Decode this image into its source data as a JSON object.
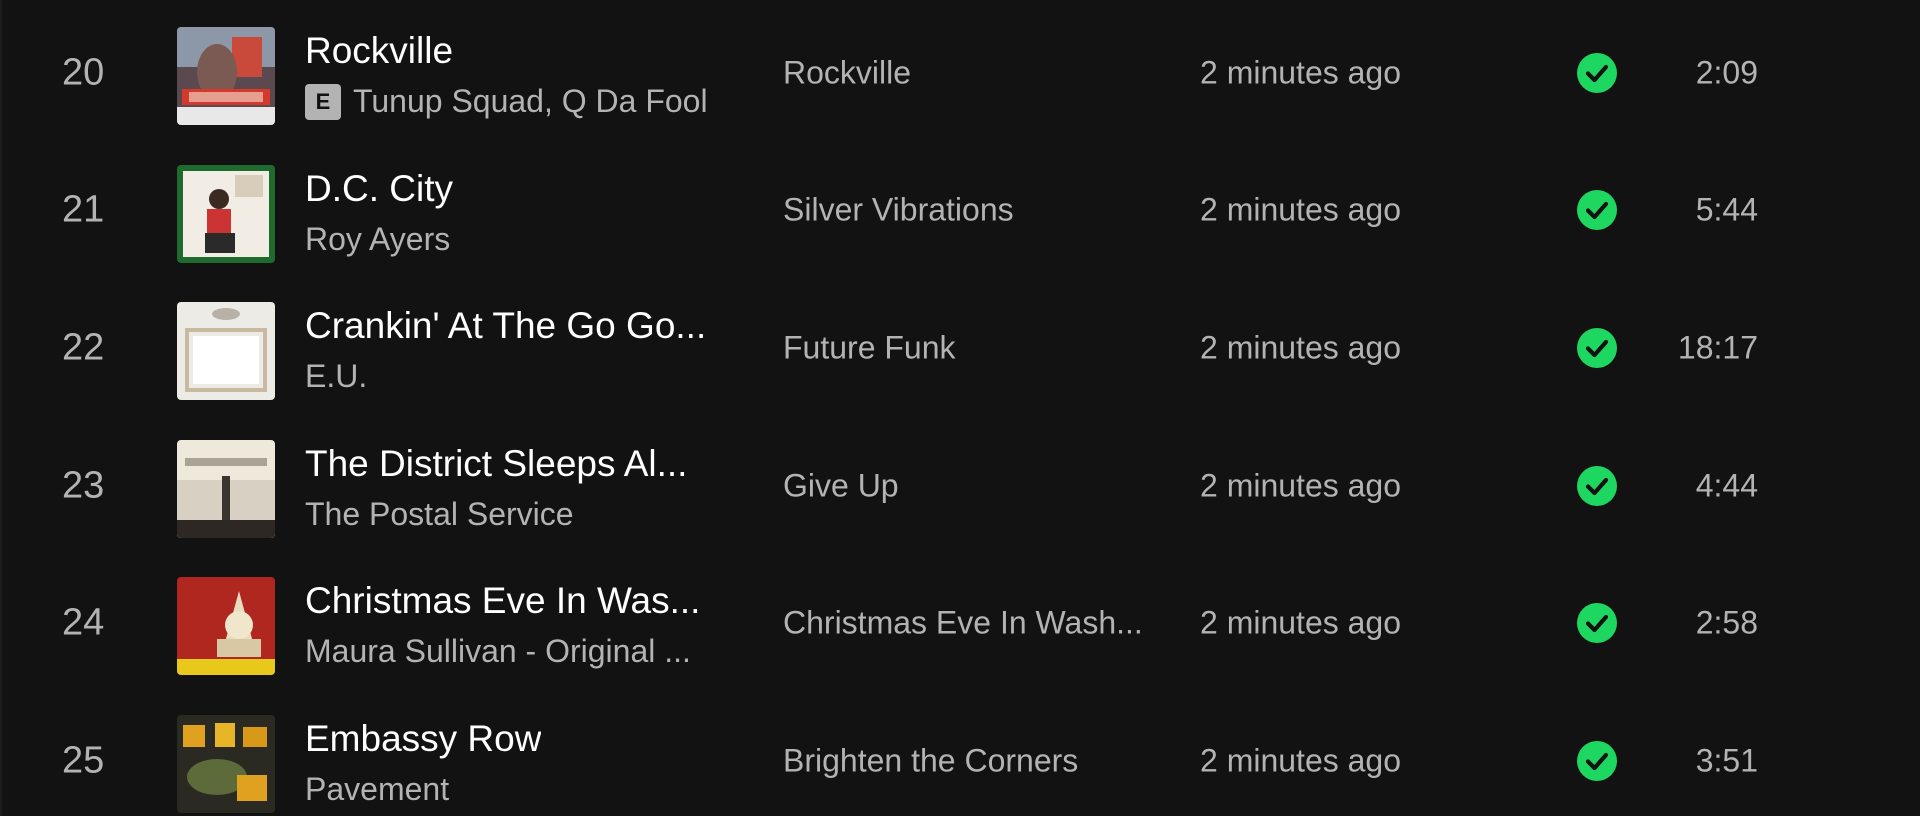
{
  "colors": {
    "background": "#121212",
    "primary_text": "#ffffff",
    "secondary_text": "#b3b3b3",
    "downloaded_green": "#1ed760"
  },
  "tracks": [
    {
      "index": "20",
      "title": "Rockville",
      "explicit": "E",
      "artist": "Tunup Squad, Q Da Fool",
      "album": "Rockville",
      "added": "2 minutes ago",
      "duration": "2:09",
      "status_icon": "downloaded-check-icon"
    },
    {
      "index": "21",
      "title": "D.C. City",
      "explicit": null,
      "artist": "Roy Ayers",
      "album": "Silver Vibrations",
      "added": "2 minutes ago",
      "duration": "5:44",
      "status_icon": "downloaded-check-icon"
    },
    {
      "index": "22",
      "title": "Crankin' At The Go Go...",
      "explicit": null,
      "artist": "E.U.",
      "album": "Future Funk",
      "added": "2 minutes ago",
      "duration": "18:17",
      "status_icon": "downloaded-check-icon"
    },
    {
      "index": "23",
      "title": "The District Sleeps Al...",
      "explicit": null,
      "artist": "The Postal Service",
      "album": "Give Up",
      "added": "2 minutes ago",
      "duration": "4:44",
      "status_icon": "downloaded-check-icon"
    },
    {
      "index": "24",
      "title": "Christmas Eve In Was...",
      "explicit": null,
      "artist": "Maura Sullivan - Original ...",
      "album": "Christmas Eve In Wash...",
      "added": "2 minutes ago",
      "duration": "2:58",
      "status_icon": "downloaded-check-icon"
    },
    {
      "index": "25",
      "title": "Embassy Row",
      "explicit": null,
      "artist": "Pavement",
      "album": "Brighten the Corners",
      "added": "2 minutes ago",
      "duration": "3:51",
      "status_icon": "downloaded-check-icon"
    }
  ]
}
